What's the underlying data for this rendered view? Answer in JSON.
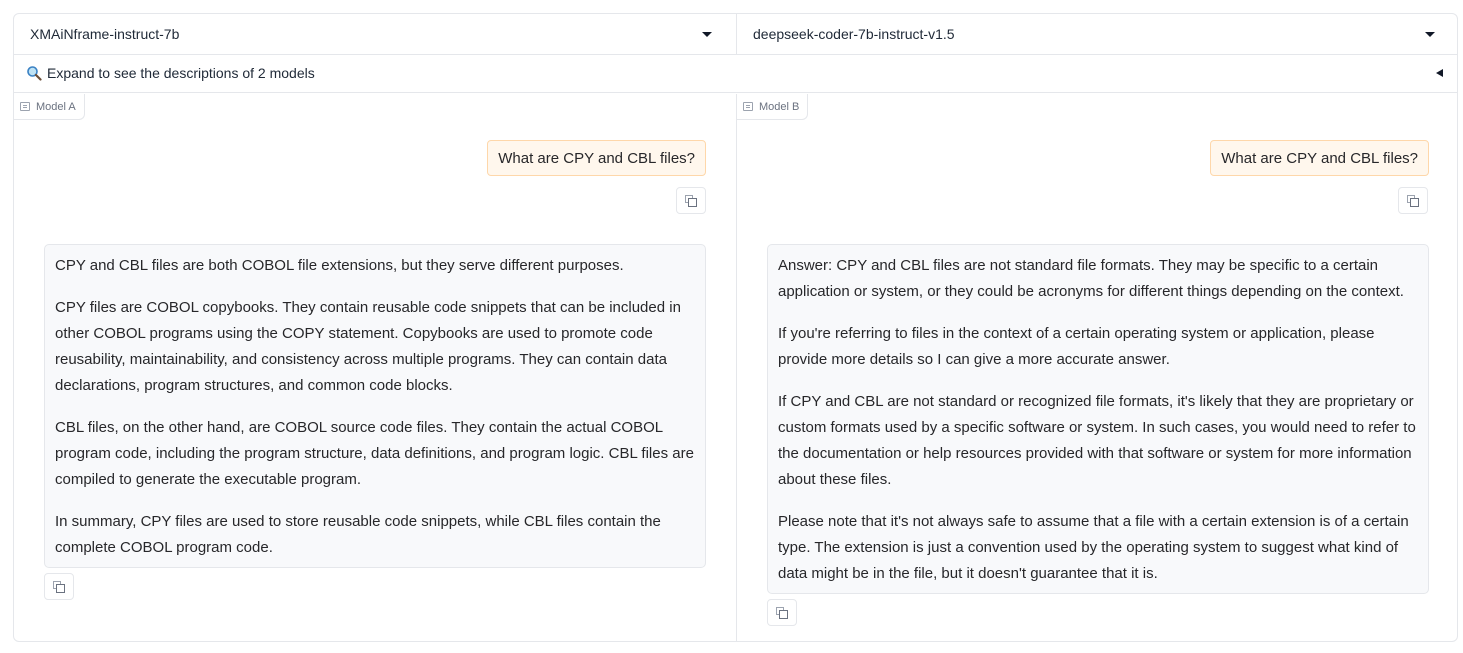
{
  "selectors": {
    "model_a": "XMAiNframe-instruct-7b",
    "model_b": "deepseek-coder-7b-instruct-v1.5"
  },
  "expander": {
    "icon": "magnifier-icon",
    "label": "Expand to see the descriptions of 2 models"
  },
  "panels": {
    "a": {
      "tag": "Model A",
      "user_message": "What are CPY and CBL files?",
      "bot_paragraphs": [
        "CPY and CBL files are both COBOL file extensions, but they serve different purposes.",
        "CPY files are COBOL copybooks. They contain reusable code snippets that can be included in other COBOL programs using the COPY statement. Copybooks are used to promote code reusability, maintainability, and consistency across multiple programs. They can contain data declarations, program structures, and common code blocks.",
        "CBL files, on the other hand, are COBOL source code files. They contain the actual COBOL program code, including the program structure, data definitions, and program logic. CBL files are compiled to generate the executable program.",
        "In summary, CPY files are used to store reusable code snippets, while CBL files contain the complete COBOL program code."
      ]
    },
    "b": {
      "tag": "Model B",
      "user_message": "What are CPY and CBL files?",
      "bot_paragraphs": [
        "Answer: CPY and CBL files are not standard file formats. They may be specific to a certain application or system, or they could be acronyms for different things depending on the context.",
        "If you're referring to files in the context of a certain operating system or application, please provide more details so I can give a more accurate answer.",
        "If CPY and CBL are not standard or recognized file formats, it's likely that they are proprietary or custom formats used by a specific software or system. In such cases, you would need to refer to the documentation or help resources provided with that software or system for more information about these files.",
        "Please note that it's not always safe to assume that a file with a certain extension is of a certain type. The extension is just a convention used by the operating system to suggest what kind of data might be in the file, but it doesn't guarantee that it is."
      ]
    }
  },
  "colors": {
    "user_bubble_bg": "#fff7ed",
    "user_bubble_border": "#fed7aa",
    "bot_bubble_bg": "#f8f9fb",
    "border": "#e5e7eb"
  }
}
